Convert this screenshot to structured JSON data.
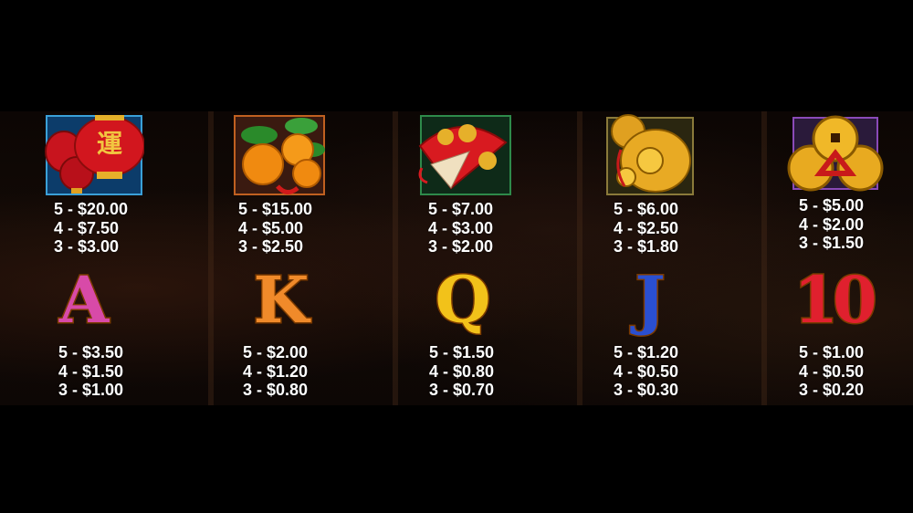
{
  "paytable": {
    "high_symbols": [
      {
        "name": "lantern",
        "char": "運",
        "pays": [
          "5 - $20.00",
          "4 - $7.50",
          "3 - $3.00"
        ]
      },
      {
        "name": "oranges",
        "pays": [
          "5 - $15.00",
          "4 - $5.00",
          "3 - $2.50"
        ]
      },
      {
        "name": "fan",
        "pays": [
          "5 - $7.00",
          "4 - $3.00",
          "3 - $2.00"
        ]
      },
      {
        "name": "gold-pouch",
        "pays": [
          "5 - $6.00",
          "4 - $2.50",
          "3 - $1.80"
        ]
      },
      {
        "name": "coins",
        "pays": [
          "5 - $5.00",
          "4 - $2.00",
          "3 - $1.50"
        ]
      }
    ],
    "low_symbols": [
      {
        "name": "A",
        "letter": "A",
        "color": "#d84aa8",
        "pays": [
          "5 - $3.50",
          "4 - $1.50",
          "3 - $1.00"
        ]
      },
      {
        "name": "K",
        "letter": "K",
        "color": "#f08a2a",
        "pays": [
          "5 - $2.00",
          "4 - $1.20",
          "3 - $0.80"
        ]
      },
      {
        "name": "Q",
        "letter": "Q",
        "color": "#f2c21a",
        "pays": [
          "5 - $1.50",
          "4 - $0.80",
          "3 - $0.70"
        ]
      },
      {
        "name": "J",
        "letter": "J",
        "color": "#2a4fd0",
        "pays": [
          "5 - $1.20",
          "4 - $0.50",
          "3 - $0.30"
        ]
      },
      {
        "name": "10",
        "letter": "10",
        "color": "#e0202e",
        "pays": [
          "5 - $1.00",
          "4 - $0.50",
          "3 - $0.20"
        ]
      }
    ]
  }
}
